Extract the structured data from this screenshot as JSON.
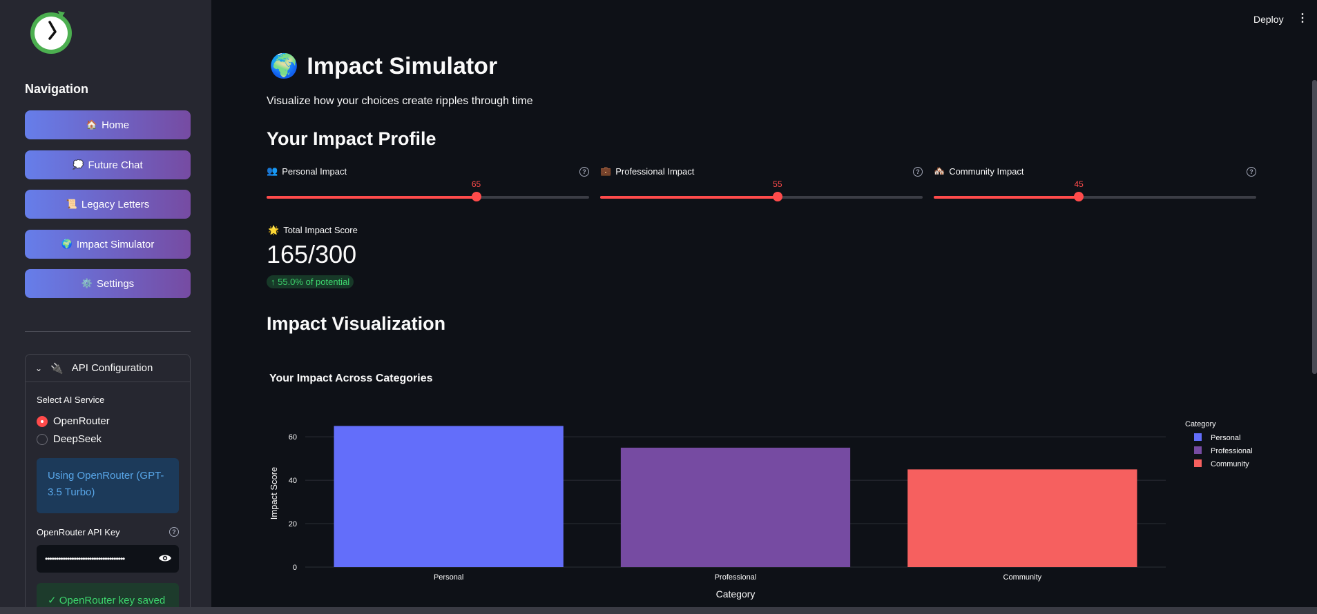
{
  "header": {
    "deploy_label": "Deploy",
    "menu_icon": "kebab-menu-icon"
  },
  "sidebar": {
    "logo_icon": "clock-logo-icon",
    "nav_title": "Navigation",
    "items": [
      {
        "icon": "🏠",
        "label": "Home"
      },
      {
        "icon": "💭",
        "label": "Future Chat"
      },
      {
        "icon": "📜",
        "label": "Legacy Letters"
      },
      {
        "icon": "🌍",
        "label": "Impact Simulator"
      },
      {
        "icon": "⚙️",
        "label": "Settings"
      }
    ],
    "api": {
      "title": "API Configuration",
      "title_icon": "🔌",
      "service_label": "Select AI Service",
      "options": [
        "OpenRouter",
        "DeepSeek"
      ],
      "selected": "OpenRouter",
      "info": "Using OpenRouter (GPT-3.5 Turbo)",
      "key_label": "OpenRouter API Key",
      "key_value": "••••••••••••••••••••••••••••••••••••",
      "success": "✓ OpenRouter key saved"
    }
  },
  "main": {
    "title_icon": "🌍",
    "title": "Impact Simulator",
    "subtitle": "Visualize how your choices create ripples through time",
    "profile_title": "Your Impact Profile",
    "sliders": [
      {
        "icon": "👥",
        "label": "Personal Impact",
        "value": 65,
        "max": 100
      },
      {
        "icon": "💼",
        "label": "Professional Impact",
        "value": 55,
        "max": 100
      },
      {
        "icon": "🏘️",
        "label": "Community Impact",
        "value": 45,
        "max": 100
      }
    ],
    "total": {
      "icon": "🌟",
      "label": "Total Impact Score",
      "value": "165/300",
      "delta": "↑ 55.0% of potential"
    },
    "viz_title": "Impact Visualization"
  },
  "chart_data": {
    "type": "bar",
    "title": "Your Impact Across Categories",
    "categories": [
      "Personal",
      "Professional",
      "Community"
    ],
    "values": [
      65,
      55,
      45
    ],
    "colors": [
      "#636efa",
      "#764ba2",
      "#f6605f"
    ],
    "xlabel": "Category",
    "ylabel": "Impact Score",
    "ylim": [
      0,
      68
    ],
    "yticks": [
      0,
      20,
      40,
      60
    ],
    "grid": true,
    "legend": {
      "title": "Category",
      "position": "top-right",
      "entries": [
        "Personal",
        "Professional",
        "Community"
      ]
    }
  }
}
